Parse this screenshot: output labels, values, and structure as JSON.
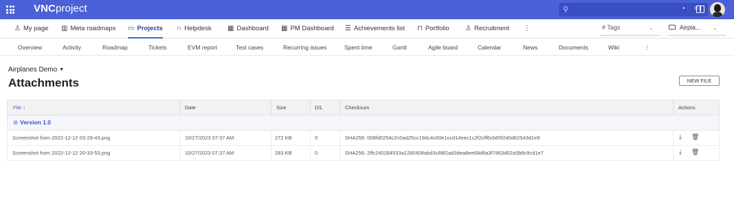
{
  "app": {
    "brand_bold": "VNC",
    "brand_rest": "project"
  },
  "search": {
    "placeholder": ""
  },
  "main_nav": {
    "items": [
      {
        "label": "My page",
        "icon": "user-icon"
      },
      {
        "label": "Meta roadmaps",
        "icon": "map-icon"
      },
      {
        "label": "Projects",
        "icon": "folder-icon",
        "active": true
      },
      {
        "label": "Helpdesk",
        "icon": "headset-icon"
      },
      {
        "label": "Dashboard",
        "icon": "dashboard-icon"
      },
      {
        "label": "PM Dashboard",
        "icon": "dashboard-icon"
      },
      {
        "label": "Achievements list",
        "icon": "list-icon"
      },
      {
        "label": "Portfolio",
        "icon": "briefcase-icon"
      },
      {
        "label": "Recruitment",
        "icon": "add-user-icon"
      }
    ],
    "tags_label": "Tags",
    "project_selector": "Airpla..."
  },
  "sub_nav": {
    "items": [
      "Overview",
      "Activity",
      "Roadmap",
      "Tickets",
      "EVM report",
      "Test cases",
      "Recurring issues",
      "Spent time",
      "Gantt",
      "Agile board",
      "Calendar",
      "News",
      "Documents",
      "Wiki"
    ]
  },
  "page": {
    "breadcrumb": "Airplanes Demo",
    "title": "Attachments",
    "new_file_label": "NEW FILE"
  },
  "table": {
    "headers": {
      "file": "File",
      "sort_indicator": "↑",
      "date": "Date",
      "size": "Size",
      "dl": "D/L",
      "checksum": "Checksum",
      "actions": "Actions"
    },
    "group_label": "Version 1.0",
    "rows": [
      {
        "file": "Screenshot from 2022-12-12 03-28-43.png",
        "date": "10/27/2023 07:37 AM",
        "size": "272 KB",
        "dl": "0",
        "checksum": "SHA256: 008fd0254c2c0ad25cc19dc4c60e1ccd14eec1c2f2cff6cb85f2d0d62543d1e9"
      },
      {
        "file": "Screenshot from 2022-12-12 20-33-53.png",
        "date": "10/27/2023 07:37 AM",
        "size": "283 KB",
        "dl": "0",
        "checksum": "SHA256: 2ffc240284533a1280408abd3c88f2ad3dea8ee68d8a3f7863d02a5b6c9cd1e7"
      }
    ]
  },
  "colors": {
    "topbar": "#4a61d8",
    "accent": "#3a4fc4"
  }
}
